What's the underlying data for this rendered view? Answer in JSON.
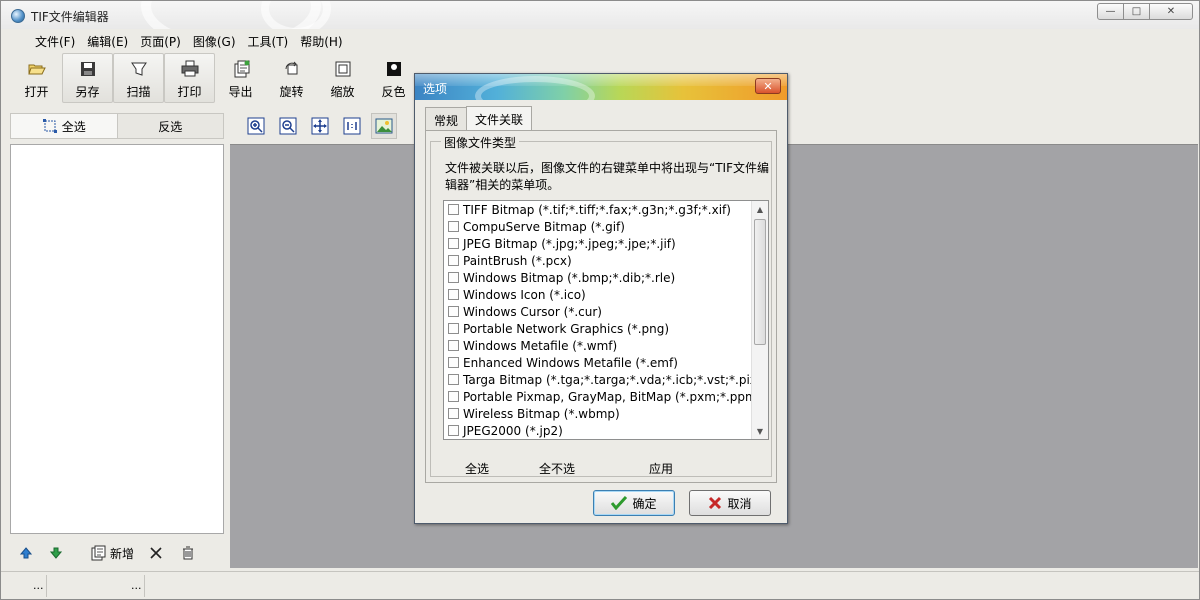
{
  "app": {
    "title": "TIF文件编辑器",
    "window_controls": {
      "minimize": "—",
      "maximize": "□",
      "close": "✕"
    }
  },
  "menu": [
    "文件(F)",
    "编辑(E)",
    "页面(P)",
    "图像(G)",
    "工具(T)",
    "帮助(H)"
  ],
  "toolbar": [
    {
      "label": "打开",
      "icon": "folder-open-icon",
      "pressed": false
    },
    {
      "label": "另存",
      "icon": "floppy-disk-icon",
      "pressed": true
    },
    {
      "label": "扫描",
      "icon": "scanner-icon",
      "pressed": true
    },
    {
      "label": "打印",
      "icon": "printer-icon",
      "pressed": true
    },
    {
      "label": "导出",
      "icon": "export-icon",
      "pressed": false
    },
    {
      "label": "旋转",
      "icon": "rotate-icon",
      "pressed": false
    },
    {
      "label": "缩放",
      "icon": "resize-icon",
      "pressed": false
    },
    {
      "label": "反色",
      "icon": "invert-color-icon",
      "pressed": false
    }
  ],
  "left_panel": {
    "select_all": "全选",
    "invert_select": "反选",
    "footer": {
      "move_up": "",
      "move_down": "",
      "add_label": "新增",
      "delete": "",
      "trash": ""
    }
  },
  "view_toolbar": [
    "zoom-in-icon",
    "zoom-out-icon",
    "fit-window-icon",
    "actual-size-icon",
    "image-view-icon"
  ],
  "status_bar": [
    "...",
    "...",
    ""
  ],
  "dialog": {
    "title": "选项",
    "close": "✕",
    "tabs": [
      {
        "label": "常规",
        "active": false
      },
      {
        "label": "文件关联",
        "active": true
      }
    ],
    "group_title": "图像文件类型",
    "description": "文件被关联以后，图像文件的右键菜单中将出现与“TIF文件编辑器”相关的菜单项。",
    "file_types": [
      "TIFF Bitmap (*.tif;*.tiff;*.fax;*.g3n;*.g3f;*.xif)",
      "CompuServe Bitmap (*.gif)",
      "JPEG Bitmap (*.jpg;*.jpeg;*.jpe;*.jif)",
      "PaintBrush (*.pcx)",
      "Windows Bitmap (*.bmp;*.dib;*.rle)",
      "Windows Icon (*.ico)",
      "Windows Cursor (*.cur)",
      "Portable Network Graphics (*.png)",
      "Windows Metafile (*.wmf)",
      "Enhanced Windows Metafile (*.emf)",
      "Targa Bitmap (*.tga;*.targa;*.vda;*.icb;*.vst;*.pix)",
      "Portable Pixmap, GrayMap, BitMap (*.pxm;*.ppm;*",
      "Wireless Bitmap (*.wbmp)",
      "JPEG2000 (*.jp2)"
    ],
    "actions": {
      "select_all": "全选",
      "select_none": "全不选",
      "apply": "应用"
    },
    "ok": "确定",
    "cancel": "取消"
  }
}
